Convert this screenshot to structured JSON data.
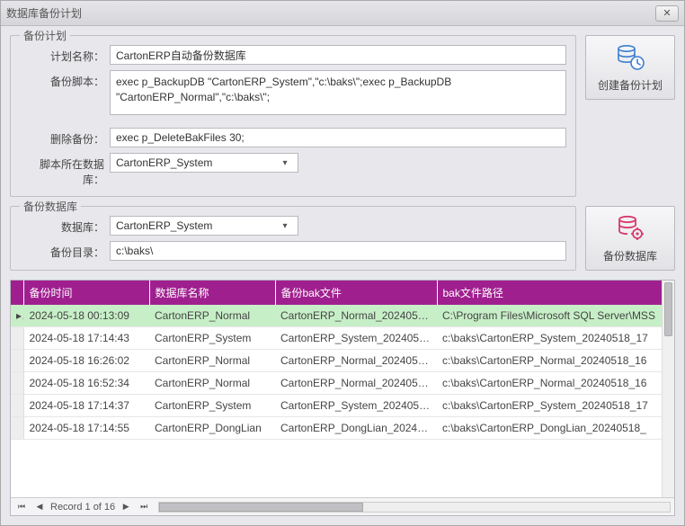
{
  "window": {
    "title": "数据库备份计划"
  },
  "plan": {
    "legend": "备份计划",
    "labels": {
      "name": "计划名称：",
      "script": "备份脚本：",
      "delete": "删除备份：",
      "db": "脚本所在数据库："
    },
    "values": {
      "name": "CartonERP自动备份数据库",
      "script": "exec p_BackupDB \"CartonERP_System\",\"c:\\baks\\\";exec p_BackupDB \"CartonERP_Normal\",\"c:\\baks\\\";",
      "delete": "exec p_DeleteBakFiles 30;",
      "db": "CartonERP_System"
    }
  },
  "create_btn_label": "创建备份计划",
  "backup_db": {
    "legend": "备份数据库",
    "labels": {
      "db": "数据库：",
      "dir": "备份目录："
    },
    "values": {
      "db": "CartonERP_System",
      "dir": "c:\\baks\\"
    }
  },
  "backup_btn_label": "备份数据库",
  "grid": {
    "columns": [
      "备份时间",
      "数据库名称",
      "备份bak文件",
      "bak文件路径"
    ],
    "rows": [
      {
        "time": "2024-05-18 00:13:09",
        "db": "CartonERP_Normal",
        "file": "CartonERP_Normal_20240518...",
        "path": "C:\\Program Files\\Microsoft SQL Server\\MSS"
      },
      {
        "time": "2024-05-18 17:14:43",
        "db": "CartonERP_System",
        "file": "CartonERP_System_2024051...",
        "path": "c:\\baks\\CartonERP_System_20240518_17"
      },
      {
        "time": "2024-05-18 16:26:02",
        "db": "CartonERP_Normal",
        "file": "CartonERP_Normal_2024051...",
        "path": "c:\\baks\\CartonERP_Normal_20240518_16"
      },
      {
        "time": "2024-05-18 16:52:34",
        "db": "CartonERP_Normal",
        "file": "CartonERP_Normal_2024051...",
        "path": "c:\\baks\\CartonERP_Normal_20240518_16"
      },
      {
        "time": "2024-05-18 17:14:37",
        "db": "CartonERP_System",
        "file": "CartonERP_System_2024051...",
        "path": "c:\\baks\\CartonERP_System_20240518_17"
      },
      {
        "time": "2024-05-18 17:14:55",
        "db": "CartonERP_DongLian",
        "file": "CartonERP_DongLian_20240...",
        "path": "c:\\baks\\CartonERP_DongLian_20240518_"
      }
    ],
    "pager": "Record 1 of 16"
  }
}
